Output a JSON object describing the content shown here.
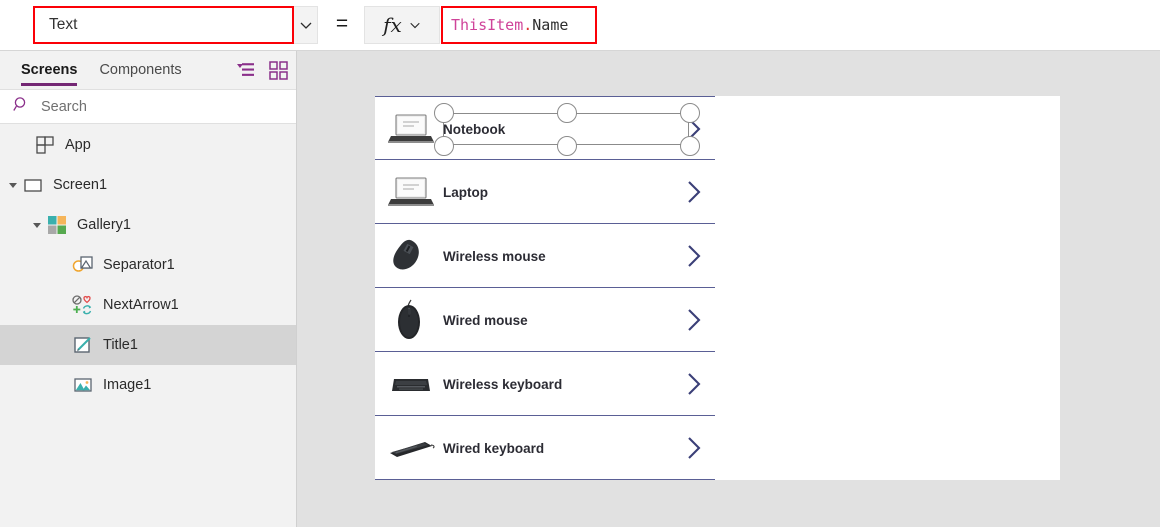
{
  "formula_bar": {
    "property_value": "Text",
    "property_chevron_icon": "chevron-down-icon",
    "equals_sign": "=",
    "fx_label": "fx",
    "fx_chevron_icon": "chevron-down-icon",
    "formula_token_identifier": "ThisItem",
    "formula_token_dot": ".",
    "formula_token_property": "Name",
    "formula_full_text": "ThisItem.Name",
    "highlight_color": "#fb0007"
  },
  "tree_panel": {
    "tabs": [
      {
        "label": "Screens",
        "active": true
      },
      {
        "label": "Components",
        "active": false
      }
    ],
    "view_icons": [
      {
        "name": "tree-view-icon"
      },
      {
        "name": "thumbnail-view-icon"
      }
    ],
    "search": {
      "icon": "search-icon",
      "placeholder": "Search",
      "value": ""
    },
    "items": [
      {
        "label": "App",
        "icon": "app-icon",
        "indent": 0,
        "expander": "none",
        "selected": false
      },
      {
        "label": "Screen1",
        "icon": "screen-icon",
        "indent": 0,
        "expander": "expanded",
        "selected": false
      },
      {
        "label": "Gallery1",
        "icon": "gallery-icon",
        "indent": 1,
        "expander": "expanded",
        "selected": false
      },
      {
        "label": "Separator1",
        "icon": "separator-icon",
        "indent": 2,
        "expander": "none",
        "selected": false
      },
      {
        "label": "NextArrow1",
        "icon": "nextarrow-icon",
        "indent": 2,
        "expander": "none",
        "selected": false
      },
      {
        "label": "Title1",
        "icon": "label-edit-icon",
        "indent": 2,
        "expander": "none",
        "selected": true
      },
      {
        "label": "Image1",
        "icon": "image-icon",
        "indent": 2,
        "expander": "none",
        "selected": false
      }
    ],
    "accent_color": "#742774",
    "selected_row_color": "#d4d4d4"
  },
  "canvas": {
    "background_color": "#e1e1e1",
    "screen_background": "#ffffff",
    "gallery": {
      "separator_color": "#5a5f95",
      "chevron_color": "#3a3f77",
      "rows": [
        {
          "label": "Notebook",
          "thumb": "laptop-thumb",
          "chevron": "chevron-right-icon",
          "selected": true
        },
        {
          "label": "Laptop",
          "thumb": "laptop-thumb",
          "chevron": "chevron-right-icon",
          "selected": false
        },
        {
          "label": "Wireless mouse",
          "thumb": "wireless-mouse-thumb",
          "chevron": "chevron-right-icon",
          "selected": false
        },
        {
          "label": "Wired mouse",
          "thumb": "wired-mouse-thumb",
          "chevron": "chevron-right-icon",
          "selected": false
        },
        {
          "label": "Wireless keyboard",
          "thumb": "wireless-keyboard-thumb",
          "chevron": "chevron-right-icon",
          "selected": false
        },
        {
          "label": "Wired keyboard",
          "thumb": "wired-keyboard-thumb",
          "chevron": "chevron-right-icon",
          "selected": false
        }
      ]
    },
    "selection": {
      "control": "Title1",
      "handle_count": 6,
      "handle_border_color": "#8b8b8b"
    }
  }
}
